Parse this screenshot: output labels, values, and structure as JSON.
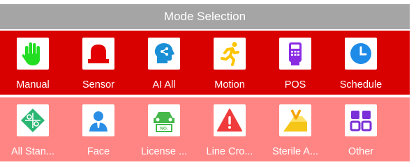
{
  "panel": {
    "title": "Mode Selection"
  },
  "rows": [
    {
      "modes": [
        {
          "label": "Manual",
          "icon": "green-hand-icon"
        },
        {
          "label": "Sensor",
          "icon": "red-alarm-light-icon"
        },
        {
          "label": "AI All",
          "icon": "ai-head-icon"
        },
        {
          "label": "Motion",
          "icon": "running-person-icon"
        },
        {
          "label": "POS",
          "icon": "pos-terminal-icon"
        },
        {
          "label": "Schedule",
          "icon": "clock-icon"
        }
      ]
    },
    {
      "modes": [
        {
          "label": "All Stan...",
          "icon": "puzzle-diamond-icon"
        },
        {
          "label": "Face",
          "icon": "face-person-icon"
        },
        {
          "label": "License ...",
          "icon": "license-plate-car-icon"
        },
        {
          "label": "Line Cro...",
          "icon": "warning-triangle-icon"
        },
        {
          "label": "Sterile A...",
          "icon": "sterile-area-icon"
        },
        {
          "label": "Other",
          "icon": "grid-squares-icon"
        }
      ]
    }
  ],
  "colors": {
    "title_bar": "#a5a5a5",
    "row_top": "#d90000",
    "row_bottom": "#ff8585"
  }
}
